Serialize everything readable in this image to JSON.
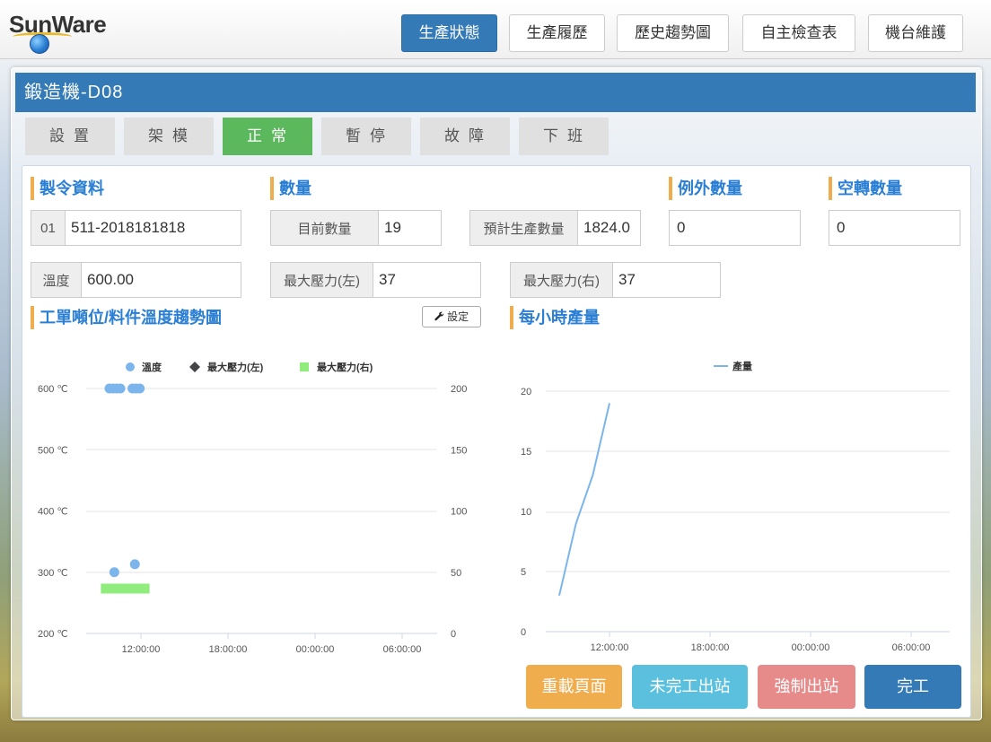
{
  "brand": {
    "logo_text": "SunWare"
  },
  "nav": {
    "items": [
      {
        "label": "生產狀態",
        "active": true
      },
      {
        "label": "生產履歷",
        "active": false
      },
      {
        "label": "歷史趨勢圖",
        "active": false
      },
      {
        "label": "自主檢查表",
        "active": false
      },
      {
        "label": "機台維護",
        "active": false
      }
    ]
  },
  "machine": {
    "title": "鍛造機-D08"
  },
  "states": [
    {
      "label": "設置",
      "active": false
    },
    {
      "label": "架模",
      "active": false
    },
    {
      "label": "正常",
      "active": true
    },
    {
      "label": "暫停",
      "active": false
    },
    {
      "label": "故障",
      "active": false
    },
    {
      "label": "下班",
      "active": false
    }
  ],
  "order": {
    "heading": "製令資料",
    "seq": "01",
    "number": "511-2018181818",
    "temp_label": "溫度",
    "temp_value": "600.00"
  },
  "quantity": {
    "heading": "數量",
    "current_label": "目前數量",
    "current_value": "19",
    "planned_label": "預計生產數量",
    "planned_value": "1824.0",
    "max_pressure_left_label": "最大壓力(左)",
    "max_pressure_left_value": "37",
    "max_pressure_right_label": "最大壓力(右)",
    "max_pressure_right_value": "37"
  },
  "exception": {
    "heading": "例外數量",
    "value": "0"
  },
  "idle": {
    "heading": "空轉數量",
    "value": "0"
  },
  "trend_chart": {
    "heading": "工單噸位/料件溫度趨勢圖",
    "settings_label": "設定",
    "settings_icon": "wrench-icon"
  },
  "hourly_chart": {
    "heading": "每小時產量"
  },
  "actions": {
    "reload": "重載頁面",
    "unfinished_out": "未完工出站",
    "force_out": "強制出站",
    "complete": "完工"
  },
  "colors": {
    "primary": "#337ab7",
    "success": "#5cb85c",
    "warning": "#f0ad4e",
    "info": "#5bc0de",
    "danger": "#e68a8a",
    "heading": "#2a7fd4"
  },
  "chart_data": [
    {
      "type": "scatter",
      "legend": [
        "溫度",
        "最大壓力(左)",
        "最大壓力(右)"
      ],
      "y_left_ticks": [
        "600 ℃",
        "500 ℃",
        "400 ℃",
        "300 ℃",
        "200 ℃"
      ],
      "y_left_range": [
        200,
        600
      ],
      "y_right_ticks": [
        "200",
        "150",
        "100",
        "50",
        "0"
      ],
      "y_right_range": [
        0,
        200
      ],
      "x_ticks": [
        "12:00:00",
        "18:00:00",
        "00:00:00",
        "06:00:00"
      ],
      "series": [
        {
          "name": "溫度",
          "marker": "circle",
          "color": "#7cb5ec",
          "points": [
            {
              "x": "09:50",
              "y": 600
            },
            {
              "x": "10:05",
              "y": 600
            },
            {
              "x": "10:20",
              "y": 600
            },
            {
              "x": "10:35",
              "y": 600
            },
            {
              "x": "11:25",
              "y": 600
            },
            {
              "x": "11:40",
              "y": 600
            },
            {
              "x": "11:55",
              "y": 600
            },
            {
              "x": "10:10",
              "y": 300
            },
            {
              "x": "11:35",
              "y": 313
            }
          ]
        },
        {
          "name": "最大壓力(左)",
          "marker": "diamond",
          "color": "#434348",
          "points": []
        },
        {
          "name": "最大壓力(右)",
          "marker": "bar",
          "color": "#90ed7d",
          "points": [
            {
              "x": "10:10",
              "y": 37
            },
            {
              "x": "11:40",
              "y": 37
            }
          ]
        }
      ]
    },
    {
      "type": "line",
      "legend": [
        "產量"
      ],
      "y_ticks": [
        "20",
        "15",
        "10",
        "5",
        "0"
      ],
      "y_range": [
        0,
        20
      ],
      "x_ticks": [
        "12:00:00",
        "18:00:00",
        "00:00:00",
        "06:00:00"
      ],
      "series": [
        {
          "name": "產量",
          "color": "#7cb5ec",
          "points": [
            {
              "x": "09:00",
              "y": 3
            },
            {
              "x": "10:00",
              "y": 9
            },
            {
              "x": "11:00",
              "y": 13
            },
            {
              "x": "12:00",
              "y": 19
            }
          ]
        }
      ]
    }
  ]
}
